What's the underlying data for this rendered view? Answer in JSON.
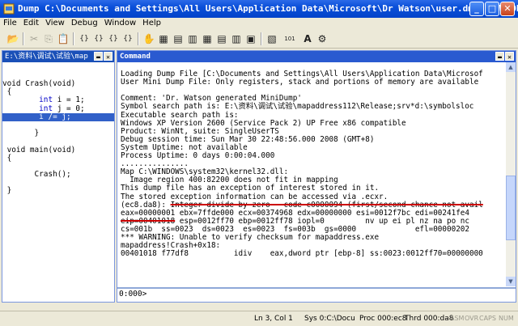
{
  "window": {
    "title": "Dump C:\\Documents and Settings\\All Users\\Application Data\\Microsoft\\Dr Watson\\user.dmp - WinDbg",
    "minimize": "_",
    "maximize": "□",
    "close": "✕"
  },
  "menu": [
    "File",
    "Edit",
    "View",
    "Debug",
    "Window",
    "Help"
  ],
  "toolbar_icons": [
    {
      "name": "open-icon",
      "glyph": "📂"
    },
    {
      "name": "cut-icon",
      "glyph": "✂"
    },
    {
      "name": "copy-icon",
      "glyph": "⎘"
    },
    {
      "name": "paste-icon",
      "glyph": "📋"
    },
    {
      "name": "step-into-icon",
      "glyph": "{}"
    },
    {
      "name": "step-over-icon",
      "glyph": "{}"
    },
    {
      "name": "step-out-icon",
      "glyph": "{}"
    },
    {
      "name": "run-to-cursor-icon",
      "glyph": "{}"
    },
    {
      "name": "breakpoint-icon",
      "glyph": "✋"
    },
    {
      "name": "watch-icon",
      "glyph": "▦"
    },
    {
      "name": "locals-icon",
      "glyph": "▤"
    },
    {
      "name": "registers-icon",
      "glyph": "▥"
    },
    {
      "name": "memory-icon",
      "glyph": "▦"
    },
    {
      "name": "call-stack-icon",
      "glyph": "▤"
    },
    {
      "name": "disassembly-icon",
      "glyph": "▥"
    },
    {
      "name": "scratch-pad-icon",
      "glyph": "▣"
    },
    {
      "name": "source-mode-icon",
      "glyph": "▧"
    },
    {
      "name": "hex-mode-icon",
      "glyph": "101"
    },
    {
      "name": "font-icon",
      "glyph": "A"
    },
    {
      "name": "options-icon",
      "glyph": "⚙"
    }
  ],
  "source_window": {
    "title": "E:\\资料\\调试\\试验\\map",
    "lines": [
      {
        "text": "void Crash(void)",
        "hl": false
      },
      {
        "text": " {",
        "hl": false
      },
      {
        "text": "        int i = 1;",
        "hl": false
      },
      {
        "text": "        int j = 0;",
        "hl": false
      },
      {
        "text": "        i /= j;",
        "hl": true
      },
      {
        "text": "",
        "hl": false
      },
      {
        "text": "       }",
        "hl": false
      },
      {
        "text": "",
        "hl": false
      },
      {
        "text": " void main(void)",
        "hl": false
      },
      {
        "text": " {",
        "hl": false
      },
      {
        "text": "",
        "hl": false
      },
      {
        "text": "       Crash();",
        "hl": false
      },
      {
        "text": "",
        "hl": false
      },
      {
        "text": " }",
        "hl": false
      }
    ]
  },
  "command_window": {
    "title": "Command",
    "output": [
      "",
      "Loading Dump File [C:\\Documents and Settings\\All Users\\Application Data\\Microsof",
      "User Mini Dump File: Only registers, stack and portions of memory are available",
      "",
      "Comment: 'Dr. Watson generated MiniDump'",
      "Symbol search path is: E:\\资料\\调试\\试验\\mapaddress112\\Release;srv*d:\\symbolsloc",
      "Executable search path is:",
      "Windows XP Version 2600 (Service Pack 2) UP Free x86 compatible",
      "Product: WinNt, suite: SingleUserTS",
      "Debug session time: Sun Mar 30 22:48:56.000 2008 (GMT+8)",
      "System Uptime: not available",
      "Process Uptime: 0 days 0:00:04.000",
      "...............",
      "Map C:\\WINDOWS\\system32\\kernel32.dll:",
      "  Image region 400:82200 does not fit in mapping",
      "This dump file has an exception of interest stored in it.",
      "The stored exception information can be accessed via .ecxr.",
      "(ec8.da8): Integer divide-by-zero - code c0000094 (first/second chance not avail",
      "eax=00000001 ebx=7ffde000 ecx=00374968 edx=00000000 esi=0012f7bc edi=00241fe4",
      "eip=00401018 esp=0012ff70 ebp=0012ff78 iopl=0         nv up ei pl nz na po nc",
      "cs=001b  ss=0023  ds=0023  es=0023  fs=003b  gs=0000             efl=00000202",
      "*** WARNING: Unable to verify checksum for mapaddress.exe",
      "mapaddress!Crash+0x18:",
      "00401018 f77df8          idiv    eax,dword ptr [ebp-8] ss:0023:0012ff70=00000000"
    ],
    "prompt": "0:000>",
    "input_value": ""
  },
  "statusbar": {
    "position": "Ln 3, Col 1",
    "sys": "Sys 0:C:\\Docu",
    "proc": "Proc 000:ec8",
    "thrd": "Thrd 000:da8",
    "asm": "ASM",
    "ovr": "OVR",
    "caps": "CAPS",
    "num": "NUM"
  },
  "colors": {
    "titlebar": "#0a4fd9",
    "source_keyword": "#0000c8",
    "highlight": "#3160c8",
    "strike": "#cc0000"
  }
}
